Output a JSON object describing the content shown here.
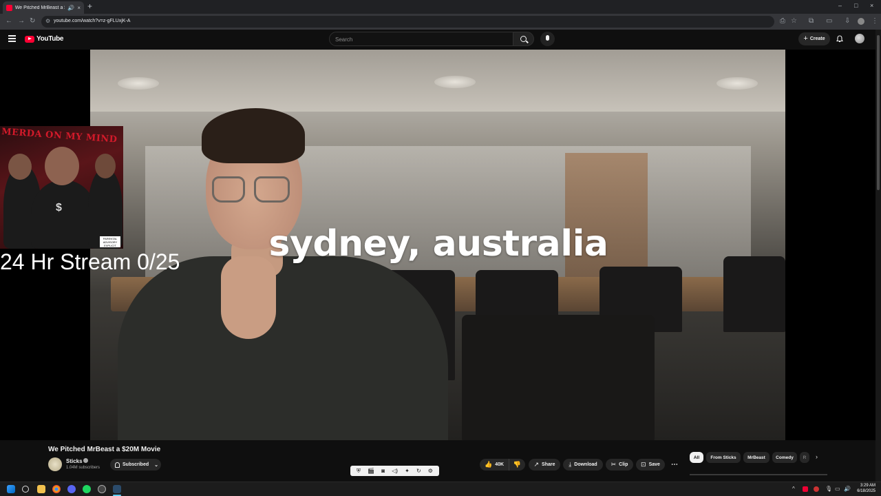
{
  "browser": {
    "tab_title": "We Pitched MrBeast a $20M",
    "tab_speaker_icon": "speaker-icon",
    "tab_close": "×",
    "new_tab": "+",
    "url": "youtube.com/watch?v=z-gFLUxjK-A",
    "window_minimize": "–",
    "window_maximize": "□",
    "window_close": "×"
  },
  "youtube": {
    "logo_text": "YouTube",
    "search_placeholder": "Search",
    "create_label": "Create",
    "create_plus": "+"
  },
  "video": {
    "caption": "sydney, australia",
    "overlay_stream_text": "24 Hr Stream 0/25",
    "album_title": "MERDA ON MY MIND",
    "album_dollar": "$",
    "advisory_text": "PARENTAL ADVISORY EXPLICIT CONTENT"
  },
  "watch": {
    "title": "We Pitched MrBeast a $20M Movie",
    "channel_name": "Sticks",
    "subscribers": "1.04M subscribers",
    "subscribe_label": "Subscribed",
    "subscribe_chev": "⌄",
    "like_count": "40K",
    "share_label": "Share",
    "download_label": "Download",
    "clip_label": "Clip",
    "save_label": "Save",
    "more_label": "⋯",
    "chips": [
      "All",
      "From Sticks",
      "MrBeast",
      "Comedy",
      "R"
    ],
    "chip_next": "›"
  },
  "taskbar": {
    "time": "3:29 AM",
    "date": "6/18/2025"
  }
}
